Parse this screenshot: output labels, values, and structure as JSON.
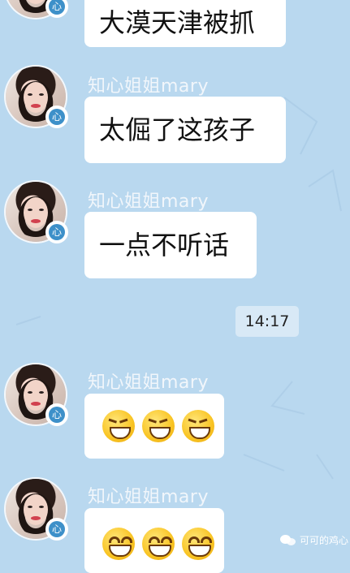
{
  "chat": {
    "messages": [
      {
        "id": "m1",
        "text": "大漠天津被抓"
      },
      {
        "id": "m2",
        "sender": "知心姐姐mary",
        "badge": "心",
        "text": "太倔了这孩子"
      },
      {
        "id": "m3",
        "sender": "知心姐姐mary",
        "badge": "心",
        "text": "一点不听话"
      },
      {
        "id": "m4",
        "sender": "知心姐姐mary",
        "badge": "心",
        "emoji": [
          "grin-emoji",
          "grin-emoji",
          "grin-emoji"
        ]
      },
      {
        "id": "m5",
        "sender": "知心姐姐mary",
        "badge": "心",
        "emoji": [
          "happy-emoji",
          "happy-emoji",
          "happy-emoji"
        ]
      }
    ],
    "timestamp": "14:17",
    "top_badge": "心"
  },
  "watermark": {
    "text": "可可的鸡心"
  },
  "colors": {
    "background": "#b9d8ef",
    "bubble": "#ffffff",
    "badge": "#3d90c9",
    "name": "#f1f6fb"
  }
}
